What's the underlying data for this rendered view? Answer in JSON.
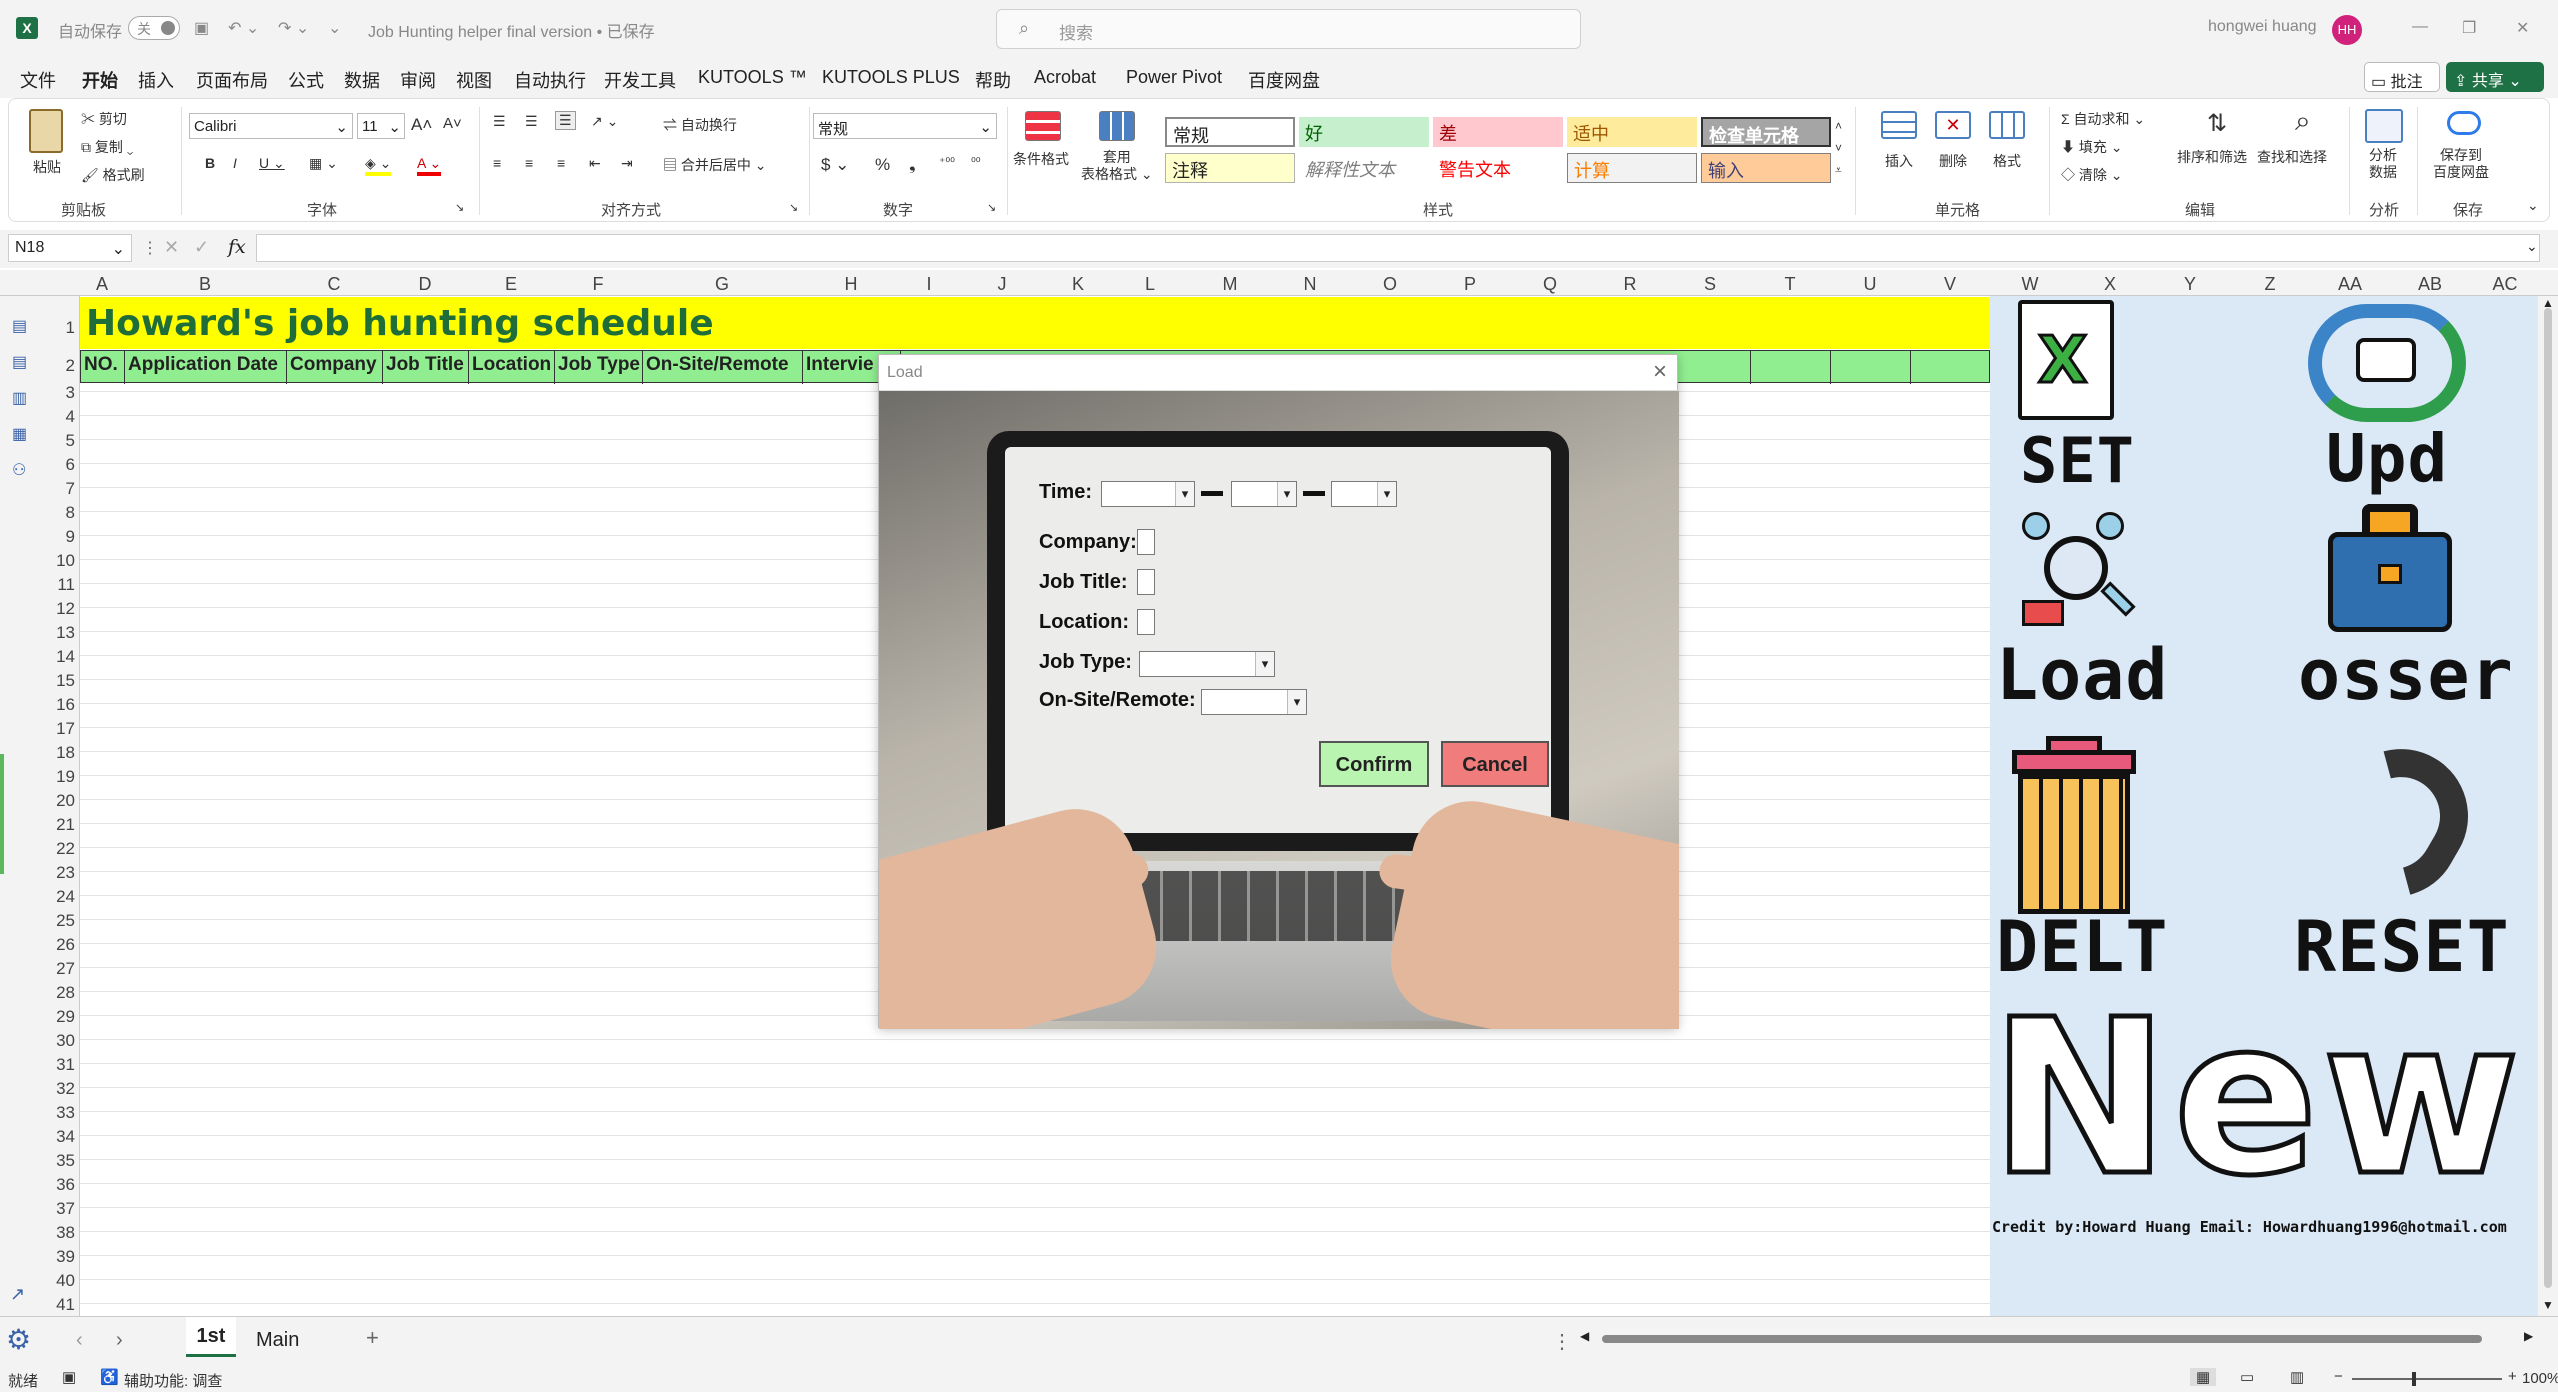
{
  "titlebar": {
    "autosave": "自动保存",
    "toggle": "关",
    "doc_title": "Job Hunting helper final version • 已保存",
    "search_placeholder": "搜索",
    "user": "hongwei huang",
    "initials": "HH"
  },
  "menu": {
    "items": [
      "文件",
      "开始",
      "插入",
      "页面布局",
      "公式",
      "数据",
      "审阅",
      "视图",
      "自动执行",
      "开发工具",
      "KUTOOLS ™",
      "KUTOOLS PLUS",
      "帮助",
      "Acrobat",
      "Power Pivot",
      "百度网盘"
    ],
    "comment_btn": "批注",
    "share_btn": "共享"
  },
  "ribbon": {
    "paste": "粘贴",
    "cut": "剪切",
    "copy": "复制",
    "format_painter": "格式刷",
    "clipboard": "剪贴板",
    "font_name": "Calibri",
    "font_size": "11",
    "font_group": "字体",
    "wrap": "自动换行",
    "merge": "合并后居中",
    "align_group": "对齐方式",
    "number_format": "常规",
    "number_group": "数字",
    "cond_format": "条件格式",
    "table_format": "套用\n表格格式",
    "styles": [
      "常规",
      "好",
      "差",
      "适中",
      "检查单元格",
      "注释",
      "解释性文本",
      "警告文本",
      "计算",
      "输入"
    ],
    "styles_group": "样式",
    "insert": "插入",
    "delete": "删除",
    "format": "格式",
    "cells_group": "单元格",
    "autosum": "自动求和",
    "fill": "填充",
    "clear": "清除",
    "sort": "排序和筛选",
    "find": "查找和选择",
    "edit_group": "编辑",
    "analyze": "分析\n数据",
    "analyze_group": "分析",
    "save_baidu": "保存到\n百度网盘",
    "save_group": "保存"
  },
  "formula": {
    "namebox": "N18",
    "fx": "fx"
  },
  "columns": [
    "A",
    "B",
    "C",
    "D",
    "E",
    "F",
    "G",
    "H",
    "I",
    "J",
    "K",
    "L",
    "M",
    "N",
    "O",
    "P",
    "Q",
    "R",
    "S",
    "T",
    "U",
    "V",
    "W",
    "X",
    "Y",
    "Z",
    "AA",
    "AB",
    "AC"
  ],
  "rows": [
    "1",
    "2",
    "3",
    "4",
    "5",
    "6",
    "7",
    "8",
    "9",
    "10",
    "11",
    "12",
    "13",
    "14",
    "15",
    "16",
    "17",
    "18",
    "19",
    "20",
    "21",
    "22",
    "23",
    "24",
    "25",
    "26",
    "27",
    "28",
    "29",
    "30",
    "31",
    "32",
    "33",
    "34",
    "35",
    "36",
    "37",
    "38",
    "39",
    "40",
    "41"
  ],
  "sheet": {
    "title": "Howard's job hunting schedule",
    "headers": [
      "NO.",
      "Application Date",
      "Company",
      "Job Title",
      "Location",
      "Job Type",
      "On-Site/Remote",
      "Intervie"
    ]
  },
  "panel": {
    "set": "SET",
    "upd": "Upd",
    "load": "Load",
    "osser": "osser",
    "delt": "DELT",
    "reset": "RESET",
    "new": "New",
    "credit": "Credit by:Howard Huang Email: Howardhuang1996@hotmail.com"
  },
  "dialog": {
    "title": "Load",
    "close": "×",
    "time_label": "Time:",
    "company_label": "Company:",
    "job_title_label": "Job Title:",
    "location_label": "Location:",
    "job_type_label": "Job Type:",
    "onsite_label": "On-Site/Remote:",
    "confirm": "Confirm",
    "cancel": "Cancel"
  },
  "tabs": {
    "sheets": [
      "1st",
      "Main"
    ],
    "add": "+"
  },
  "status": {
    "ready": "就绪",
    "accessibility": "辅助功能: 调查",
    "zoom": "100%"
  },
  "colors": {
    "excel_green": "#1e7145",
    "title_yellow": "#ffff00",
    "header_green": "#90ee90",
    "panel_blue": "#dbe8f6",
    "confirm_green": "#b9f5b0",
    "cancel_red": "#f07c7c"
  }
}
